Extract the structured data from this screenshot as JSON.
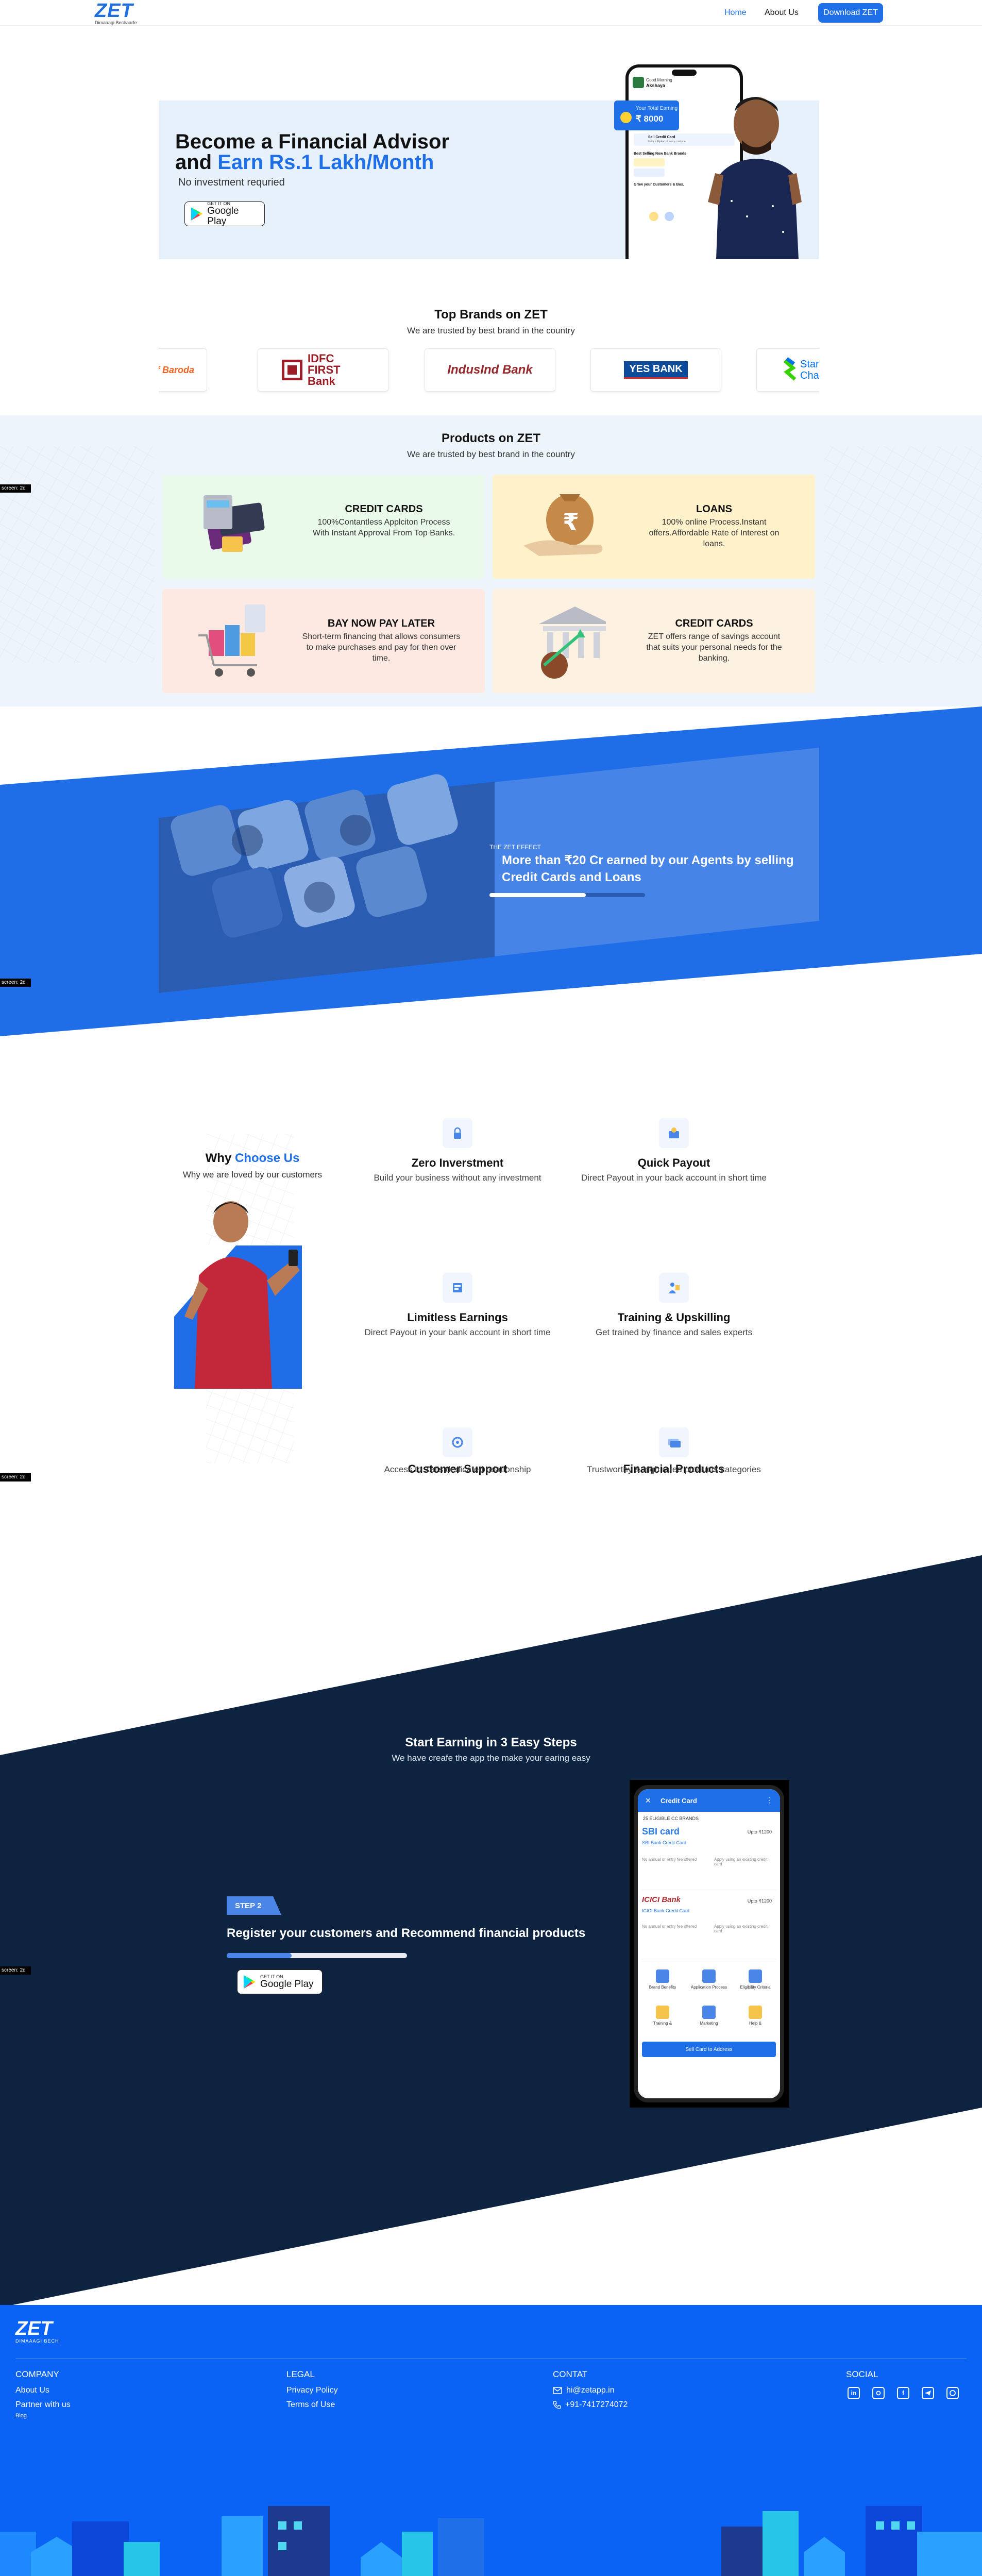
{
  "nav": {
    "logo": "ZET",
    "logo_tagline": "Dimaaagi Bechaarfe",
    "home": "Home",
    "about": "About Us",
    "download": "Download ZET"
  },
  "hero": {
    "title_line1": "Become a Financial Advisor",
    "title_line2_prefix": "and ",
    "title_line2_highlight": "Earn Rs.1 Lakh/Month",
    "subtitle": "No investment requried",
    "play_small": "GET IT ON",
    "play_big": "Google Play",
    "phone_user": "Good Morning",
    "phone_user_name": "Akshaya",
    "earn_label": "Your Total Earning",
    "earn_value": "₹ 8000",
    "phone_row1": "Sell Credit Card",
    "phone_row1_sub": "Unlock Flipkart of every customer",
    "phone_row2": "Best Selling Now Bank Brands",
    "phone_row3": "Grow your Customers & Bus."
  },
  "brands": {
    "title": "Top Brands on ZET",
    "subtitle": "We are trusted by best brand in the country",
    "items": [
      {
        "name": "...of Baroda",
        "color": "#f26522"
      },
      {
        "name": "IDFC FIRST Bank",
        "color": "#9c1d26"
      },
      {
        "name": "IndusInd Bank",
        "color": "#98272a"
      },
      {
        "name": "YES BANK",
        "color": "#0d4c9a"
      },
      {
        "name": "Standard Chartered",
        "color": "#0473ea"
      }
    ]
  },
  "products": {
    "title": "Products on ZET",
    "subtitle": "We are trusted by best brand in the country",
    "items": [
      {
        "title": "CREDIT CARDS",
        "desc": "100%Contantless Applciton Process With Instant Approval From Top Banks.",
        "bg": "#eafaea"
      },
      {
        "title": "LOANS",
        "desc": "100% online Process.Instant offers.Affordable Rate of Interest on loans.",
        "bg": "#fff1c9"
      },
      {
        "title": "BAY NOW PAY LATER",
        "desc": "Short-term financing that allows consumers to make purchases and pay for then over time.",
        "bg": "#fde9e1"
      },
      {
        "title": "CREDIT CARDS",
        "desc": "ZET offers range of savings account that suits your personal needs for the banking.",
        "bg": "#fdf1e1"
      }
    ]
  },
  "effect": {
    "kicker": "THE ZET EFFECT",
    "headline": "More than ₹20 Cr earned by our Agents by selling Credit Cards and Loans",
    "progress": 0.62
  },
  "why": {
    "title_prefix": "Why ",
    "title_highlight": "Choose Us",
    "subtitle": "Why we are loved by our customers",
    "features": [
      {
        "icon": "lock-icon",
        "title": "Zero Inverstment",
        "desc": "Build your business without any investment"
      },
      {
        "icon": "wallet-icon",
        "title": "Quick Payout",
        "desc": "Direct Payout in your back account in short time"
      },
      {
        "icon": "earnings-icon",
        "title": "Limitless Earnings",
        "desc": "Direct Payout in your bank account in short time"
      },
      {
        "icon": "training-icon",
        "title": "Training & Upskilling",
        "desc": "Get trained by finance and sales experts"
      },
      {
        "icon": "support-icon",
        "title": "Customer Support",
        "desc": "Access to Zet's dedicated relationship"
      },
      {
        "icon": "cards-icon",
        "title": "Financial Products",
        "desc": "Trustworthy & high rated products categories"
      }
    ]
  },
  "side_tag": "screen: 2d",
  "steps": {
    "title": "Start Earning in 3 Easy Steps",
    "subtitle": "We have creafe the app the make your earing easy",
    "step_label": "STEP 2",
    "step_text": "Register your customers and Recommend financial products",
    "progress": 0.36,
    "play_small": "GET IT ON",
    "play_big": "Google Play",
    "phone_header": "Credit Card",
    "phone_banner": "25 ELIGIBLE CC BRANDS",
    "phone_card1": "SBI Bank Credit Card",
    "phone_card1_brand": "SBI card",
    "phone_card1_earn": "Upto ₹1200",
    "phone_card1_note1": "No annual or entry fee offered",
    "phone_card1_note2": "Apply using an existing credit card",
    "phone_card2": "ICICI Bank Credit Card",
    "phone_card2_brand": "ICICI Bank",
    "phone_card2_earn": "Upto ₹1200",
    "phone_card2_note1": "No annual or entry fee offered",
    "phone_card2_note2": "Apply using an existing credit card",
    "phone_grid": [
      "Brand Benefits",
      "Application Process",
      "Eligibility Criteria",
      "Training &",
      "Marketing",
      "Help &"
    ],
    "phone_cta": "Sell Card to Address"
  },
  "footer": {
    "logo": "ZET",
    "logo_tagline": "DIMAAAGI BECH",
    "company_head": "COMPANY",
    "company_links": [
      "About Us",
      "Partner with us",
      "Blog"
    ],
    "legal_head": "LEGAL",
    "legal_links": [
      "Privacy Policy",
      "Terms of Use"
    ],
    "contact_head": "CONTAT",
    "email": "hi@zetapp.in",
    "phone": "+91-7417274072",
    "social_head": "SOCIAL",
    "social": [
      "linkedin-icon",
      "instagram-icon",
      "facebook-icon",
      "telegram-icon",
      "whatsapp-icon"
    ]
  }
}
